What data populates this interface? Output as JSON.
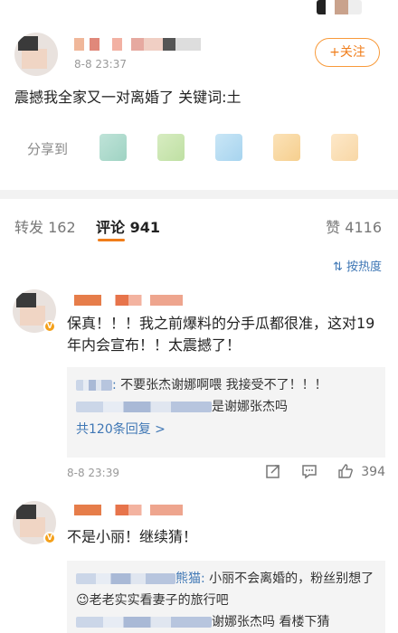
{
  "post": {
    "time": "8-8 23:37",
    "follow_label": "+关注",
    "text": "震撼我全家又一对离婚了 关键词:土",
    "share_label": "分享到"
  },
  "tabs": [
    {
      "label": "转发",
      "count": "162"
    },
    {
      "label": "评论",
      "count": "941"
    },
    {
      "label": "赞",
      "count": "4116"
    }
  ],
  "sort_label": "按热度",
  "comments": [
    {
      "text": "保真！！！我之前爆料的分手瓜都很准，这对19年内会宣布！！太震撼了！",
      "replies": [
        {
          "user_suffix": ":",
          "text": " 不要张杰谢娜啊喂 我接受不了！！！"
        },
        {
          "user_suffix": "",
          "text": "是谢娜张杰吗"
        }
      ],
      "more_replies": "共120条回复 >",
      "time": "8-8 23:39",
      "likes": "394"
    },
    {
      "text": "不是小丽！继续猜！",
      "replies": [
        {
          "user_suffix": "熊猫:",
          "text": " 小丽不会离婚的，粉丝别想了😉老老实实看妻子的旅行吧"
        },
        {
          "user_suffix": "",
          "text": "谢娜张杰吗 看楼下猜"
        }
      ]
    }
  ],
  "icons": {
    "share": "share-icon",
    "comment": "comment-icon",
    "like": "thumbs-up-icon",
    "sort": "sort-icon"
  },
  "colors": {
    "accent": "#f07d1a",
    "link": "#3f77b5",
    "verified": "#f4a01a"
  }
}
